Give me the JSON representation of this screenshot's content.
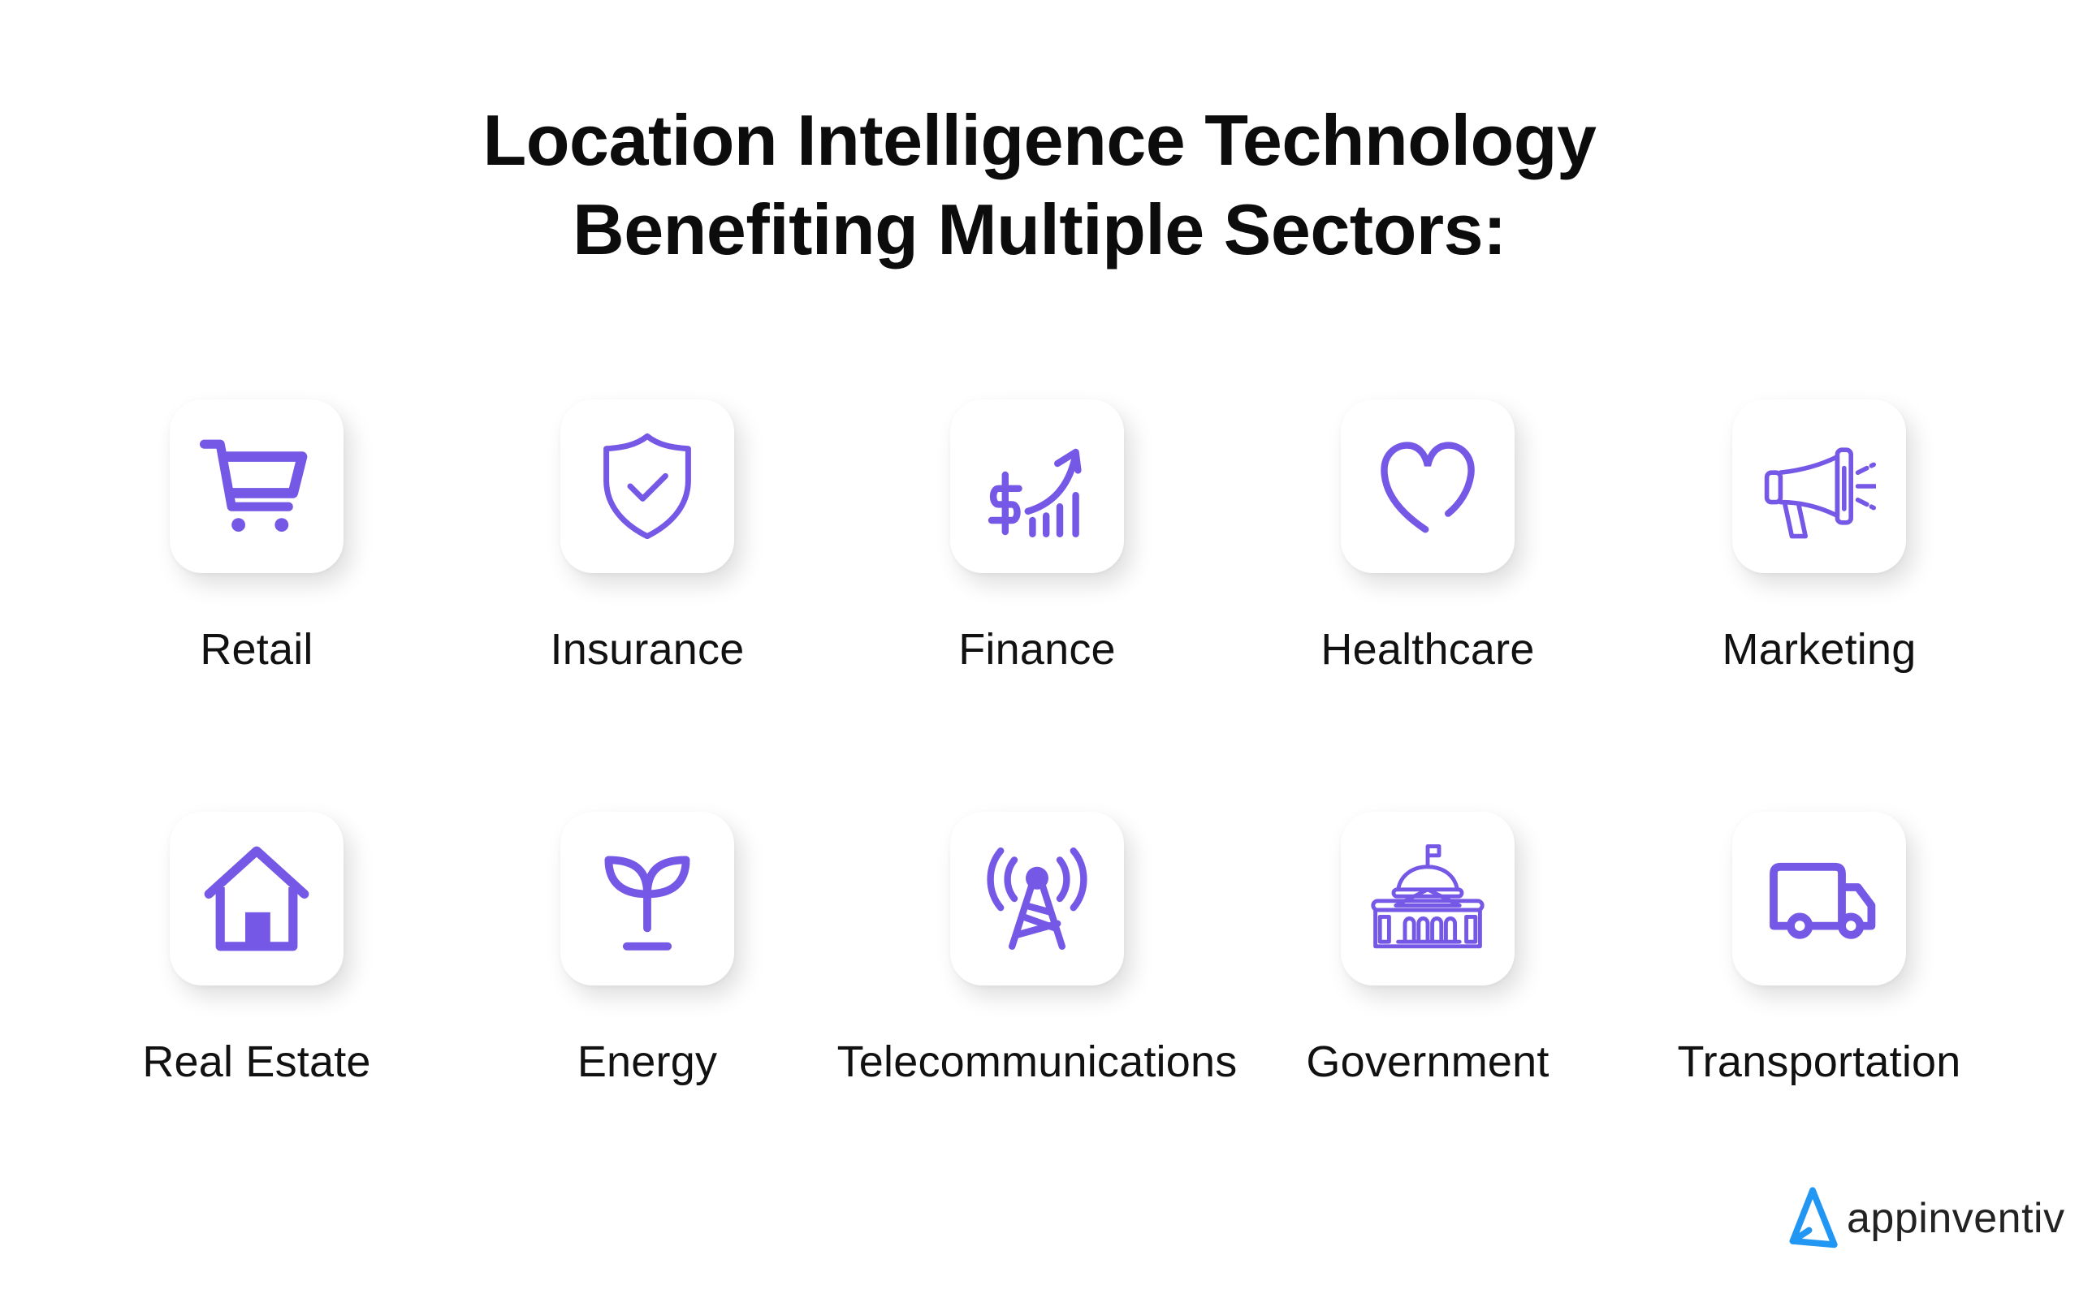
{
  "title": {
    "line1": "Location Intelligence Technology",
    "line2": "Benefiting Multiple Sectors:"
  },
  "colors": {
    "accent": "#7658E6",
    "logo_blue": "#2196F3",
    "text": "#111111",
    "background": "#FFFFFF"
  },
  "sectors": [
    {
      "label": "Retail",
      "icon": "shopping-cart-icon"
    },
    {
      "label": "Insurance",
      "icon": "shield-check-icon"
    },
    {
      "label": "Finance",
      "icon": "dollar-growth-chart-icon"
    },
    {
      "label": "Healthcare",
      "icon": "heart-icon"
    },
    {
      "label": "Marketing",
      "icon": "megaphone-icon"
    },
    {
      "label": "Real Estate",
      "icon": "house-icon"
    },
    {
      "label": "Energy",
      "icon": "plant-sprout-icon"
    },
    {
      "label": "Telecommunications",
      "icon": "radio-tower-icon"
    },
    {
      "label": "Government",
      "icon": "capitol-building-icon"
    },
    {
      "label": "Transportation",
      "icon": "delivery-truck-icon"
    }
  ],
  "brand": {
    "name": "appinventiv",
    "icon": "appinventiv-logo-icon"
  }
}
